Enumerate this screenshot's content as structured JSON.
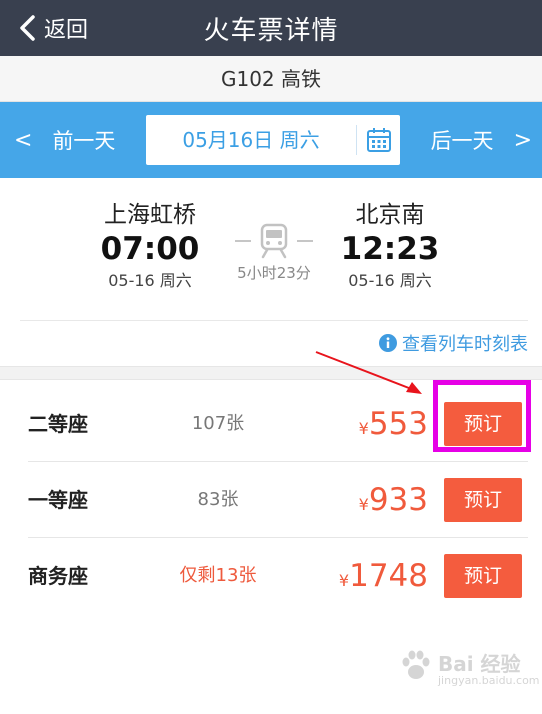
{
  "header": {
    "back_label": "返回",
    "title": "火车票详情"
  },
  "train": {
    "number_label": "G102 高铁"
  },
  "date_bar": {
    "prev_label": "前一天",
    "next_label": "后一天",
    "date_label": "05月16日 周六"
  },
  "journey": {
    "departure": {
      "station": "上海虹桥",
      "time": "07:00",
      "date": "05-16 周六"
    },
    "arrival": {
      "station": "北京南",
      "time": "12:23",
      "date": "05-16 周六"
    },
    "duration": "5小时23分"
  },
  "timetable_link": "查看列车时刻表",
  "seats": [
    {
      "name": "二等座",
      "count": "107张",
      "currency": "¥",
      "price": "553",
      "book_label": "预订",
      "low_stock": false
    },
    {
      "name": "一等座",
      "count": "83张",
      "currency": "¥",
      "price": "933",
      "book_label": "预订",
      "low_stock": false
    },
    {
      "name": "商务座",
      "count": "仅剩13张",
      "currency": "¥",
      "price": "1748",
      "book_label": "预订",
      "low_stock": true
    }
  ],
  "watermark": {
    "main": "Bai 经验",
    "sub": "jingyan.baidu.com"
  },
  "colors": {
    "header_bg": "#39404f",
    "date_bar_bg": "#45a6e8",
    "price_red": "#f05a3c",
    "book_button": "#f45c3e",
    "link_blue": "#3f9be0",
    "annotation_magenta": "#e600e6",
    "annotation_arrow": "#e8141c"
  }
}
